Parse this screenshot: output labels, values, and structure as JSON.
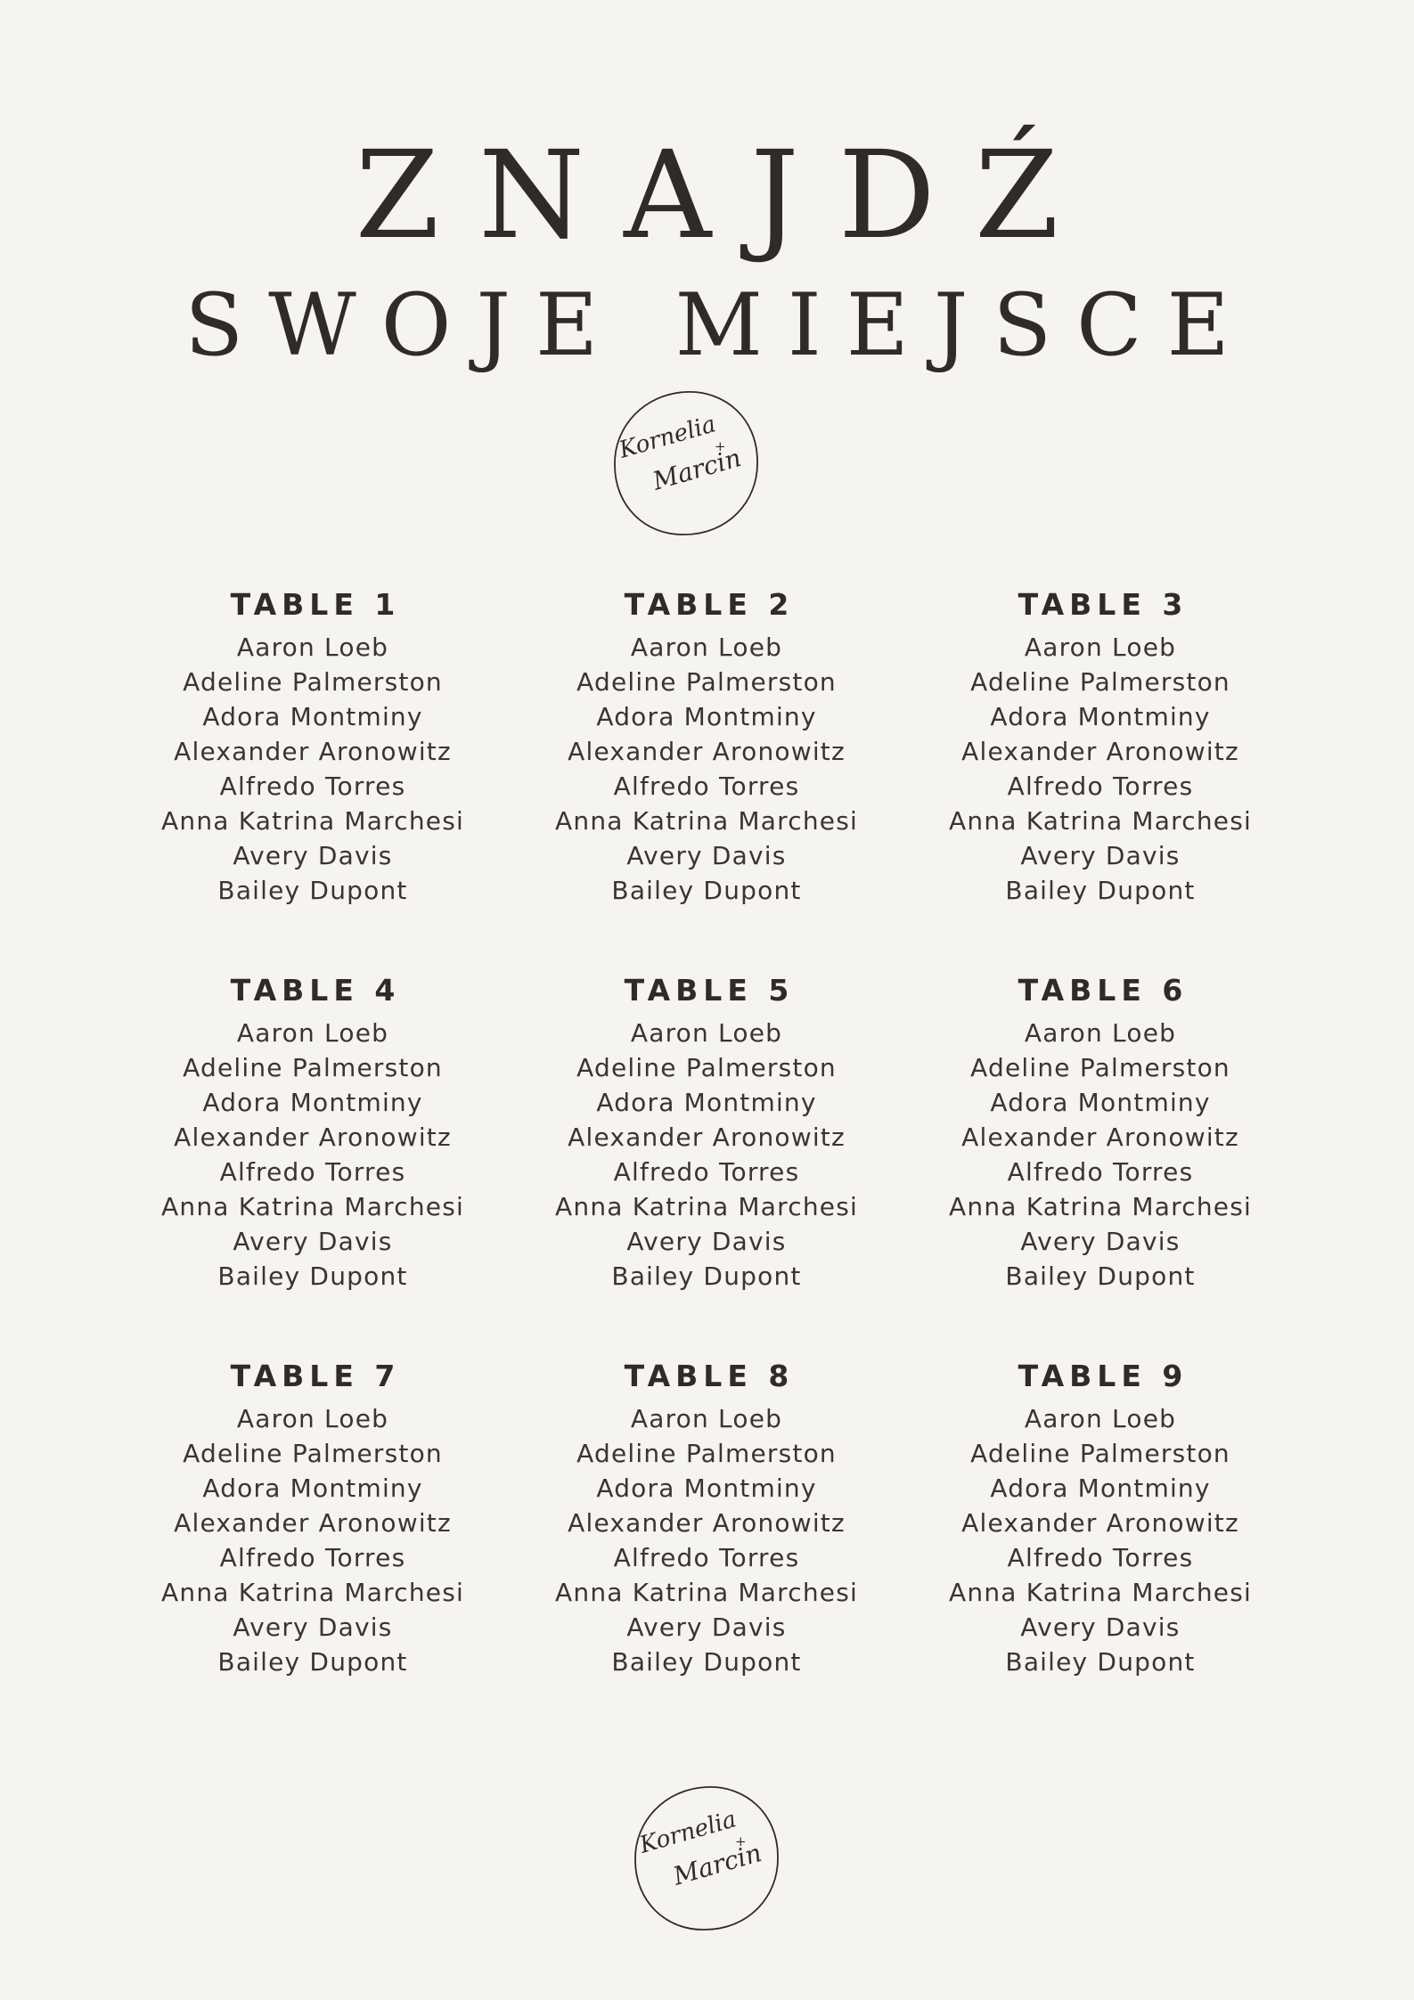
{
  "title": {
    "line1": "ZNAJDŹ",
    "line2": "SWOJE MIEJSCE"
  },
  "logo": {
    "text_line1": "Kornelia",
    "plus": "+",
    "text_line2": "Marcin",
    "icon": "couple-monogram-logo"
  },
  "tables": [
    {
      "title": "TABLE 1",
      "guests": [
        "Aaron Loeb",
        "Adeline Palmerston",
        "Adora Montminy",
        "Alexander Aronowitz",
        "Alfredo Torres",
        "Anna Katrina Marchesi",
        "Avery Davis",
        "Bailey Dupont"
      ]
    },
    {
      "title": "TABLE 2",
      "guests": [
        "Aaron Loeb",
        "Adeline Palmerston",
        "Adora Montminy",
        "Alexander Aronowitz",
        "Alfredo Torres",
        "Anna Katrina Marchesi",
        "Avery Davis",
        "Bailey Dupont"
      ]
    },
    {
      "title": "TABLE 3",
      "guests": [
        "Aaron Loeb",
        "Adeline Palmerston",
        "Adora Montminy",
        "Alexander Aronowitz",
        "Alfredo Torres",
        "Anna Katrina Marchesi",
        "Avery Davis",
        "Bailey Dupont"
      ]
    },
    {
      "title": "TABLE 4",
      "guests": [
        "Aaron Loeb",
        "Adeline Palmerston",
        "Adora Montminy",
        "Alexander Aronowitz",
        "Alfredo Torres",
        "Anna Katrina Marchesi",
        "Avery Davis",
        "Bailey Dupont"
      ]
    },
    {
      "title": "TABLE 5",
      "guests": [
        "Aaron Loeb",
        "Adeline Palmerston",
        "Adora Montminy",
        "Alexander Aronowitz",
        "Alfredo Torres",
        "Anna Katrina Marchesi",
        "Avery Davis",
        "Bailey Dupont"
      ]
    },
    {
      "title": "TABLE 6",
      "guests": [
        "Aaron Loeb",
        "Adeline Palmerston",
        "Adora Montminy",
        "Alexander Aronowitz",
        "Alfredo Torres",
        "Anna Katrina Marchesi",
        "Avery Davis",
        "Bailey Dupont"
      ]
    },
    {
      "title": "TABLE 7",
      "guests": [
        "Aaron Loeb",
        "Adeline Palmerston",
        "Adora Montminy",
        "Alexander Aronowitz",
        "Alfredo Torres",
        "Anna Katrina Marchesi",
        "Avery Davis",
        "Bailey Dupont"
      ]
    },
    {
      "title": "TABLE 8",
      "guests": [
        "Aaron Loeb",
        "Adeline Palmerston",
        "Adora Montminy",
        "Alexander Aronowitz",
        "Alfredo Torres",
        "Anna Katrina Marchesi",
        "Avery Davis",
        "Bailey Dupont"
      ]
    },
    {
      "title": "TABLE 9",
      "guests": [
        "Aaron Loeb",
        "Adeline Palmerston",
        "Adora Montminy",
        "Alexander Aronowitz",
        "Alfredo Torres",
        "Anna Katrina Marchesi",
        "Avery Davis",
        "Bailey Dupont"
      ]
    }
  ],
  "colors": {
    "background": "#f6f4f0",
    "text": "#3a3531",
    "heading": "#2f2b28"
  }
}
